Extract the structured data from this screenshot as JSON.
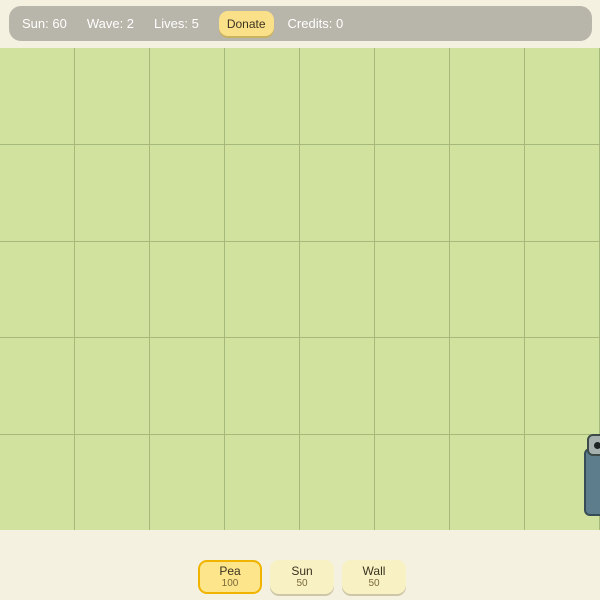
{
  "hud": {
    "sun": "Sun: 60",
    "wave": "Wave: 2",
    "lives": "Lives: 5",
    "donate_label": "Donate",
    "credits": "Credits: 0"
  },
  "board": {
    "columns": 8,
    "rows": 5,
    "grass_color": "#d1e29e"
  },
  "cards": [
    {
      "name": "Pea",
      "cost": "100",
      "selected": true
    },
    {
      "name": "Sun",
      "cost": "50",
      "selected": false
    },
    {
      "name": "Wall",
      "cost": "50",
      "selected": false
    }
  ]
}
